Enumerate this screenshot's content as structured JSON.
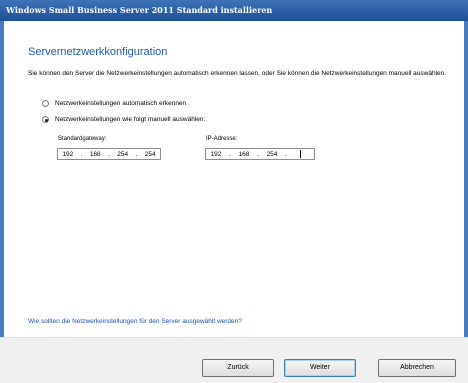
{
  "window": {
    "title": "Windows Small Business Server 2011 Standard installieren"
  },
  "page": {
    "heading": "Servernetzwerkkonfiguration",
    "description": "Sie können den Server die Netzwerkeinstellungen automatisch erkennen lassen, oder Sie können die Netzwerkeinstellungen manuell auswählen."
  },
  "options": {
    "auto_label": "Netzwerkeinstellungen automatisch erkennen",
    "manual_label": "Netzwerkeinstellungen wie folgt manuell auswählen:",
    "selected": "manual"
  },
  "fields": {
    "gateway_label": "Standardgateway:",
    "gateway_octets": [
      "192",
      "168",
      "254",
      "254"
    ],
    "ip_label": "IP-Adresse:",
    "ip_octets": [
      "192",
      "168",
      "254",
      ""
    ]
  },
  "help_link": "Wie sollten die Netzwerkeinstellungen für den Server ausgewählt werden?",
  "buttons": {
    "back": "Zurück",
    "next": "Weiter",
    "cancel": "Abbrechen"
  }
}
